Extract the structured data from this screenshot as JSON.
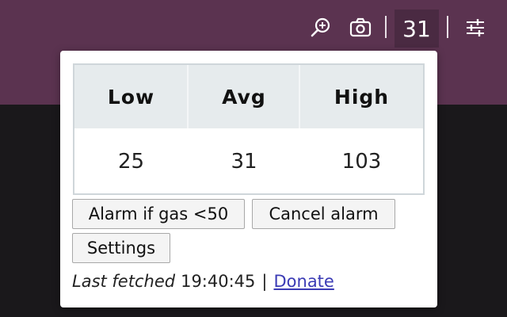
{
  "toolbar": {
    "icons": [
      "zoom-in-icon",
      "camera-icon",
      "sliders-icon"
    ],
    "gas_badge_value": "31",
    "colors": {
      "bar": "#5b3350",
      "badge": "#4a2a42",
      "background": "#1a181b"
    }
  },
  "popup": {
    "table": {
      "headers": [
        "Low",
        "Avg",
        "High"
      ],
      "values": [
        "25",
        "31",
        "103"
      ]
    },
    "buttons": {
      "alarm": "Alarm if gas <50",
      "cancel_alarm": "Cancel alarm",
      "settings": "Settings"
    },
    "footer": {
      "last_fetched_label": "Last fetched",
      "last_fetched_time": "19:40:45",
      "separator": "|",
      "donate_link": "Donate"
    }
  }
}
